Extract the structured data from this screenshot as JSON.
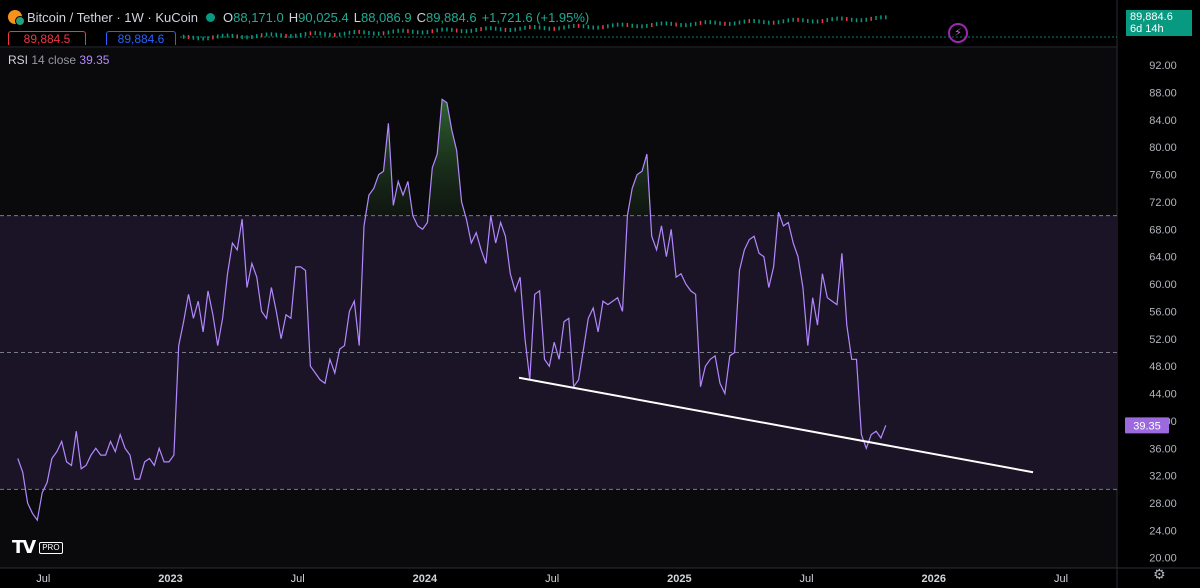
{
  "header": {
    "title": "Bitcoin / Tether · 1W · KuCoin",
    "ohlc": [
      {
        "k": "O",
        "v": "88,171.0"
      },
      {
        "k": "H",
        "v": "90,025.4"
      },
      {
        "k": "L",
        "v": "88,086.9"
      },
      {
        "k": "C",
        "v": "89,884.6"
      }
    ],
    "change": "+1,721.6 (+1.95%)",
    "sell_price": "89,884.5",
    "buy_price": "89,884.6",
    "price_label": "89,884.6",
    "countdown": "6d 14h"
  },
  "icons": {
    "coin": "bitcoin-tether-icon",
    "status": "market-open-dot-icon",
    "flash": "lightning-icon",
    "settings": "gear-icon",
    "logo": "tradingview-logo"
  },
  "logo_badge": "PRO",
  "rsi": {
    "name": "RSI",
    "params": "14 close",
    "value": "39.35"
  },
  "colors": {
    "background": "#000000",
    "rsi_line": "#b388ff",
    "band": "#1a1426",
    "overbought_fill": "#2e5a2a",
    "price_up": "#089981",
    "price_down": "#f23645",
    "trend_line": "#ffffff"
  },
  "chart_data": {
    "type": "line",
    "title": "",
    "xlabel": "",
    "ylabel": "",
    "ylim": [
      18.5,
      94.5
    ],
    "y_ticks": [
      "92.00",
      "88.00",
      "84.00",
      "80.00",
      "76.00",
      "72.00",
      "68.00",
      "64.00",
      "60.00",
      "56.00",
      "52.00",
      "48.00",
      "44.00",
      "40.00",
      "36.00",
      "32.00",
      "28.00",
      "24.00",
      "20.00"
    ],
    "x_ticks": [
      "Jul",
      "2023",
      "Jul",
      "2024",
      "Jul",
      "2025",
      "Jul",
      "2026",
      "Jul"
    ],
    "x_tick_positions": [
      2022.5,
      2023.0,
      2023.5,
      2024.0,
      2024.5,
      2025.0,
      2025.5,
      2026.0,
      2026.5
    ],
    "levels": {
      "upper": 70,
      "middle": 50,
      "lower": 30
    },
    "series": [
      {
        "name": "",
        "x_start": 2022.4,
        "x_step_years": 0.019165,
        "values": [
          34.5,
          32.5,
          28,
          26.5,
          25.5,
          29.5,
          31,
          34.5,
          35.5,
          37,
          34,
          33.5,
          38.5,
          33,
          33.5,
          35,
          36,
          35,
          35,
          37,
          35.5,
          38,
          36,
          35,
          31.5,
          31.5,
          34,
          34.5,
          33.5,
          36,
          34,
          34,
          35,
          51,
          54.5,
          58.5,
          55,
          57.5,
          53,
          59,
          55.5,
          51,
          55,
          61.5,
          66,
          65,
          69.5,
          59.5,
          63,
          61,
          56,
          55,
          59.5,
          56,
          52,
          55.5,
          55,
          62.5,
          62.5,
          62,
          48,
          47,
          46,
          45.5,
          49,
          47,
          50.5,
          51,
          56,
          57.5,
          51,
          68.5,
          73,
          74,
          76,
          76.5,
          83.5,
          71.5,
          75,
          73,
          75,
          70,
          68.5,
          68,
          69,
          77,
          79,
          87,
          86.5,
          82.5,
          79.5,
          72,
          69.5,
          66,
          67.5,
          65,
          63,
          70,
          66,
          69,
          67,
          61.5,
          59,
          61,
          52,
          46,
          58.5,
          59,
          49,
          48,
          51.5,
          49,
          54.5,
          55,
          45,
          46,
          50.5,
          55,
          56.5,
          53,
          57.5,
          57,
          57.5,
          58,
          56,
          70,
          74,
          76,
          76.5,
          79,
          67,
          65,
          68.5,
          64,
          68,
          61,
          61.5,
          60,
          59,
          58.5,
          45,
          48,
          49,
          49.5,
          45.5,
          44,
          49.5,
          50,
          62,
          65,
          66.5,
          67,
          64.5,
          64,
          59.5,
          62.5,
          70.5,
          68.5,
          69,
          66,
          64,
          59.5,
          51,
          58,
          54,
          61.5,
          58,
          57.5,
          57,
          64.5,
          54,
          49,
          49,
          38,
          36,
          38,
          38.5,
          37.5,
          39.35
        ]
      }
    ],
    "trend_line": {
      "from": {
        "x": 2024.37,
        "y": 46.3
      },
      "to": {
        "x": 2026.39,
        "y": 32.5
      }
    },
    "overbought_fill": true,
    "grid": false,
    "legend": "top-left"
  }
}
